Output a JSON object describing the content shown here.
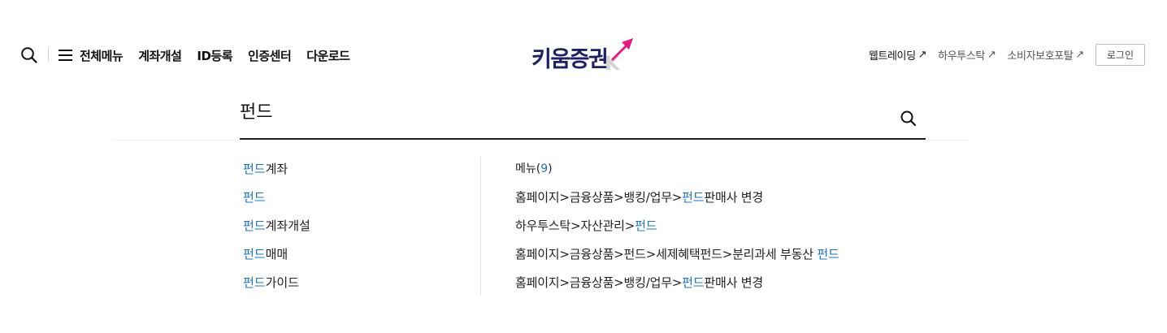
{
  "header": {
    "nav": [
      "전체메뉴",
      "계좌개설",
      "ID등록",
      "인증센터",
      "다운로드"
    ],
    "logo_text": "키움증권",
    "logo_mark": "K",
    "util_links": [
      {
        "label": "웹트레이딩",
        "arrow": "↗"
      },
      {
        "label": "하우투스탁",
        "arrow": "↗"
      },
      {
        "label": "소비자보호포탈",
        "arrow": "↗"
      }
    ],
    "login_label": "로그인"
  },
  "search": {
    "value": "펀드"
  },
  "suggestions": [
    {
      "hl": "펀드",
      "rest": "계좌"
    },
    {
      "hl": "펀드",
      "rest": ""
    },
    {
      "hl": "펀드",
      "rest": "계좌개설"
    },
    {
      "hl": "펀드",
      "rest": "매매"
    },
    {
      "hl": "펀드",
      "rest": "가이드"
    }
  ],
  "results": {
    "title": "메뉴",
    "count": "9",
    "items": [
      {
        "pre": "홈페이지>금융상품>뱅킹/업무>",
        "hl": "펀드",
        "post": "판매사 변경"
      },
      {
        "pre": "하우투스탁>자산관리>",
        "hl": "펀드",
        "post": ""
      },
      {
        "pre": "홈페이지>금융상품>펀드>세제혜택펀드>분리과세 부동산 ",
        "hl": "펀드",
        "post": ""
      },
      {
        "pre": "홈페이지>금융상품>뱅킹/업무>",
        "hl": "펀드",
        "post": "판매사 변경"
      }
    ]
  },
  "colors": {
    "highlight": "#1a73cc",
    "brand_navy": "#1e2063",
    "brand_pink": "#e5197e"
  },
  "icons": [
    "search-icon",
    "menu-icon",
    "external-link-icon"
  ]
}
